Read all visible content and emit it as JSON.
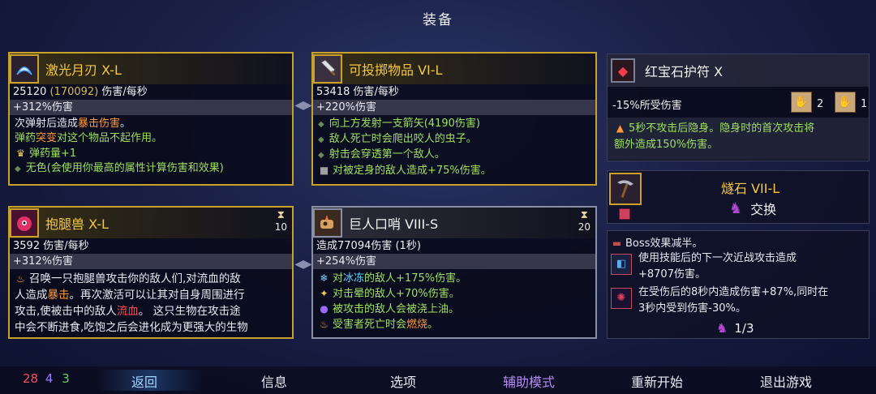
{
  "screen_title": "装备",
  "cards": {
    "laser": {
      "name": "激光月刃 X-L",
      "dmg_main": "25120",
      "dmg_paren": "(170092)",
      "dmg_unit": "伤害/每秒",
      "bonus": "+312%伤害",
      "line1a": "次弹射后造成",
      "line1b": "暴击伤害",
      "line1c": "。",
      "line2a": "弹药",
      "line2b": "突变",
      "line2c": "对这个物品不起作用。",
      "line3": "弹药量+1",
      "line4": "无色(会使用你最高的属性计算伤害和效果)"
    },
    "throw": {
      "name": "可投掷物品 VI-L",
      "dmg": "53418 伤害/每秒",
      "bonus": "+220%伤害",
      "b1": "向上方发射一支箭矢(4190伤害)",
      "b2": "敌人死亡时会爬出咬人的虫子。",
      "b3": "射击会穿透第一个敌人。",
      "b4": "对被定身的敌人造成+75%伤害。"
    },
    "legbeast": {
      "name": "抱腿兽 X-L",
      "timer": "10",
      "dmg": "3592 伤害/每秒",
      "bonus": "+312%伤害",
      "t1": "召唤一只抱腿兽攻击你的敌人们,对流血的敌",
      "t2a": "人造成",
      "t2b": "暴击",
      "t2c": "。再次激活可以让其对自身周围进行",
      "t3a": "攻击,使被击中的敌人",
      "t3b": "流血",
      "t3c": "。 这只生物在攻击途",
      "t4": "中会不断进食,吃饱之后会进化成为更强大的生物"
    },
    "whistle": {
      "name": "巨人口哨 VIII-S",
      "timer": "20",
      "dmg": "造成77094伤害 (1秒)",
      "bonus": "+254%伤害",
      "e1a": "对",
      "e1b": "冰冻",
      "e1c": "的敌人+175%伤害。",
      "e2": "对击晕的敌人+70%伤害。",
      "e3": "被攻击的敌人会被浇上油。",
      "e4a": "受害者死亡时会",
      "e4b": "燃烧",
      "e4c": "。"
    }
  },
  "amulet": {
    "name": "红宝石护符 X",
    "stat": "-15%所受伤害",
    "scroll_red": "2",
    "scroll_green": "1",
    "effect1": "5秒不攻击后隐身。隐身时的首次攻击将",
    "effect2": "额外造成150%伤害。"
  },
  "flint": {
    "name": "燧石 VII-L",
    "action": "交换"
  },
  "mutations": {
    "m1": "Boss效果减半。",
    "m2a": "使用技能后的下一次近战攻击造成",
    "m2b": "+8707伤害。",
    "m3a": "在受伤后的8秒内造成伤害+87%,同时在",
    "m3b": "3秒内受到伤害-30%。",
    "page": "1/3"
  },
  "stats": {
    "red": "28",
    "purple": "4",
    "green": "3"
  },
  "nav": {
    "back": "返回",
    "info": "信息",
    "options": "选项",
    "assist": "辅助模式",
    "restart": "重新开始",
    "quit": "退出游戏"
  },
  "icons": {
    "laser": "boomerang-icon",
    "throw": "cleaver-icon",
    "legbeast": "creature-icon",
    "whistle": "whistle-icon",
    "amulet": "ruby-amulet-icon",
    "flint": "flint-pickaxe-icon",
    "hourglass": "hourglass-icon"
  }
}
